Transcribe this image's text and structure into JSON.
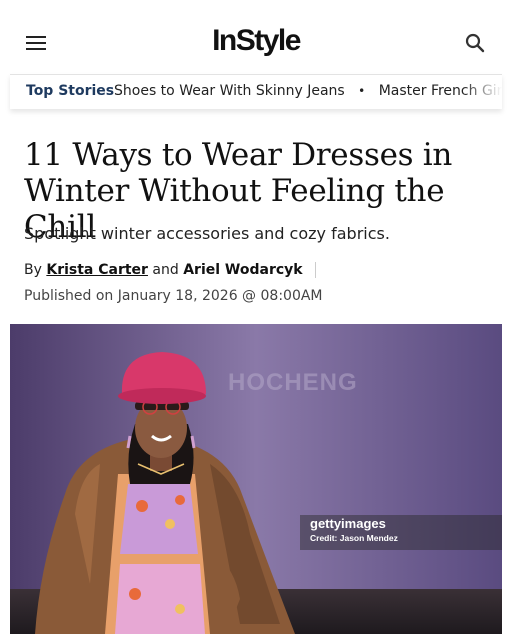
{
  "header": {
    "logo": "InStyle",
    "menu_icon": "hamburger-menu-icon",
    "search_icon": "search-icon"
  },
  "top_stories": {
    "label": "Top Stories",
    "items": [
      "Shoes to Wear With Skinny Jeans",
      "Master French Girl W"
    ],
    "separator": "•"
  },
  "article": {
    "headline": "11 Ways to Wear Dresses in Winter Without Feeling the Chill",
    "dek": "Spotlight winter accessories and cozy fabrics.",
    "by_prefix": "By",
    "authors": [
      "Krista Carter",
      "Ariel Wodarcyk"
    ],
    "and_word": "and",
    "published": "Published on January 18, 2026 @ 08:00AM"
  },
  "photo": {
    "backdrop_text": "HOCHENG",
    "watermark_brand": "gettyimages",
    "watermark_credit": "Credit: Jason Mendez"
  },
  "colors": {
    "nav_label": "#1e3a5f",
    "backdrop": "#6a5a8a",
    "hat": "#d8386a"
  }
}
